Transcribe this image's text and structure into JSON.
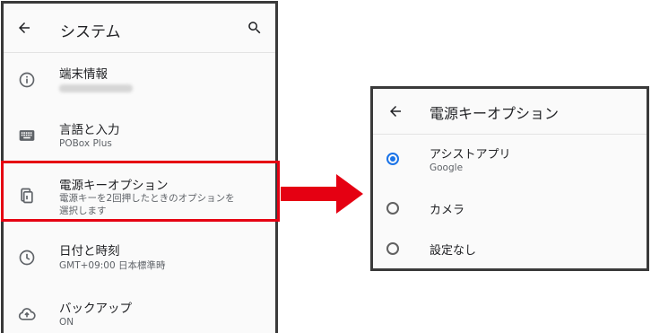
{
  "settings": {
    "title": "システム",
    "items": [
      {
        "title": "端末情報",
        "subtitle": "",
        "icon": "info-icon"
      },
      {
        "title": "言語と入力",
        "subtitle": "POBox Plus",
        "icon": "keyboard-icon"
      },
      {
        "title": "電源キーオプション",
        "subtitle_line1": "電源キーを2回押したときのオプションを",
        "subtitle_line2": "選択します",
        "icon": "power-key-icon"
      },
      {
        "title": "日付と時刻",
        "subtitle": "GMT+09:00 日本標準時",
        "icon": "clock-icon"
      },
      {
        "title": "バックアップ",
        "subtitle": "ON",
        "icon": "cloud-backup-icon"
      }
    ]
  },
  "dialog": {
    "title": "電源キーオプション",
    "options": [
      {
        "label": "アシストアプリ",
        "sub": "Google",
        "selected": true
      },
      {
        "label": "カメラ",
        "sub": "",
        "selected": false
      },
      {
        "label": "設定なし",
        "sub": "",
        "selected": false
      }
    ]
  },
  "colors": {
    "highlight": "#e50012",
    "accent": "#1a73e8",
    "frame": "#3a3a3a"
  }
}
